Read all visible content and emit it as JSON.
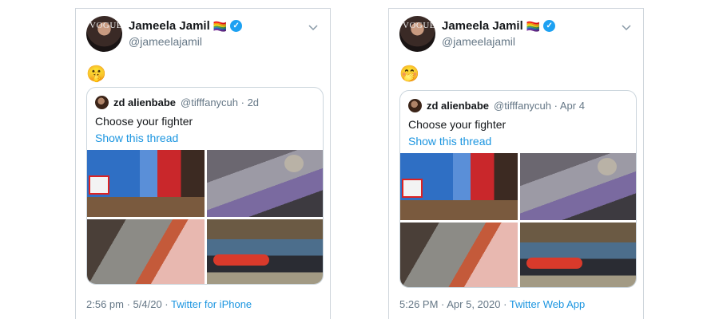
{
  "tweets": [
    {
      "display_name": "Jameela Jamil",
      "flag_emoji": "🏳️‍🌈",
      "handle": "@jameelajamil",
      "avatar_brand": "VOGUE",
      "body_emoji": "🤫",
      "quoted": {
        "name": "zd alienbabe",
        "handle_date": "@tifffanycuh · 2d",
        "text": "Choose your fighter",
        "link": "Show this thread"
      },
      "time": "2:56 pm · 5/4/20 · ",
      "source": "Twitter for iPhone"
    },
    {
      "display_name": "Jameela Jamil",
      "flag_emoji": "🏳️‍🌈",
      "handle": "@jameelajamil",
      "avatar_brand": "VOGUE",
      "body_emoji": "🤭",
      "quoted": {
        "name": "zd alienbabe",
        "handle_date": "@tifffanycuh · Apr 4",
        "text": "Choose your fighter",
        "link": "Show this thread"
      },
      "time": "5:26 PM · Apr 5, 2020 · ",
      "source": "Twitter Web App"
    }
  ],
  "icons": {
    "verified": "verified-badge-icon",
    "menu": "chevron-down-icon"
  },
  "colors": {
    "link": "#1b95e0",
    "verified": "#1da1f2",
    "muted": "#657786",
    "border": "#ccd6dd"
  }
}
